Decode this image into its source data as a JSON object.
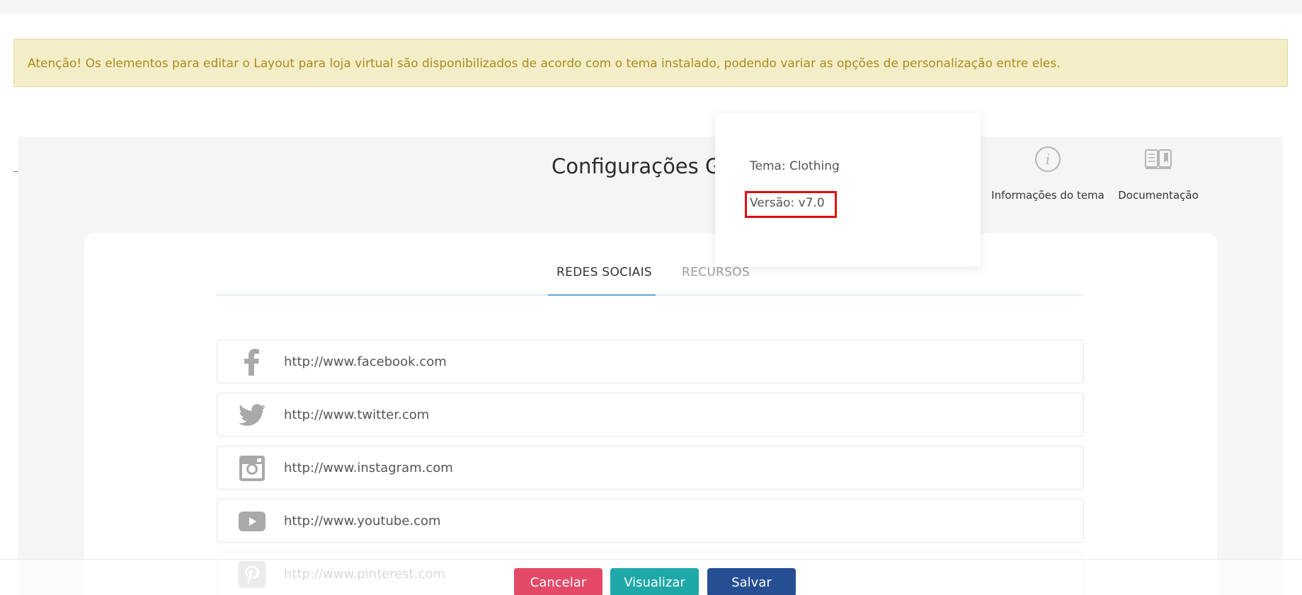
{
  "alert": {
    "text": "Atenção! Os elementos para editar o Layout para loja virtual são disponibilizados de acordo com o tema instalado, podendo variar as opções de personalização entre eles."
  },
  "header": {
    "title": "Configurações Ge",
    "actions": [
      {
        "label": "Informações do tema",
        "icon": "info-circle-icon"
      },
      {
        "label": "Documentação",
        "icon": "book-icon"
      }
    ]
  },
  "popover": {
    "theme_line": "Tema: Clothing",
    "version_line": "Versão: v7.0",
    "highlight_color": "#e00d0d"
  },
  "tabs": [
    {
      "label": "REDES SOCIAIS",
      "active": true
    },
    {
      "label": "RECURSOS",
      "active": false
    }
  ],
  "social_links": [
    {
      "icon": "facebook-icon",
      "value": "http://www.facebook.com"
    },
    {
      "icon": "twitter-icon",
      "value": "http://www.twitter.com"
    },
    {
      "icon": "instagram-icon",
      "value": "http://www.instagram.com"
    },
    {
      "icon": "youtube-icon",
      "value": "http://www.youtube.com"
    },
    {
      "icon": "pinterest-icon",
      "value": "http://www.pinterest.com"
    }
  ],
  "footer": {
    "cancel_label": "Cancelar",
    "view_label": "Visualizar",
    "save_label": "Salvar"
  },
  "colors": {
    "cancel": "#e44a67",
    "view": "#1fa8a8",
    "save": "#254f92",
    "tab_accent": "#5aa7d6",
    "alert_bg": "#f4eec8",
    "alert_text": "#a98b1d"
  }
}
